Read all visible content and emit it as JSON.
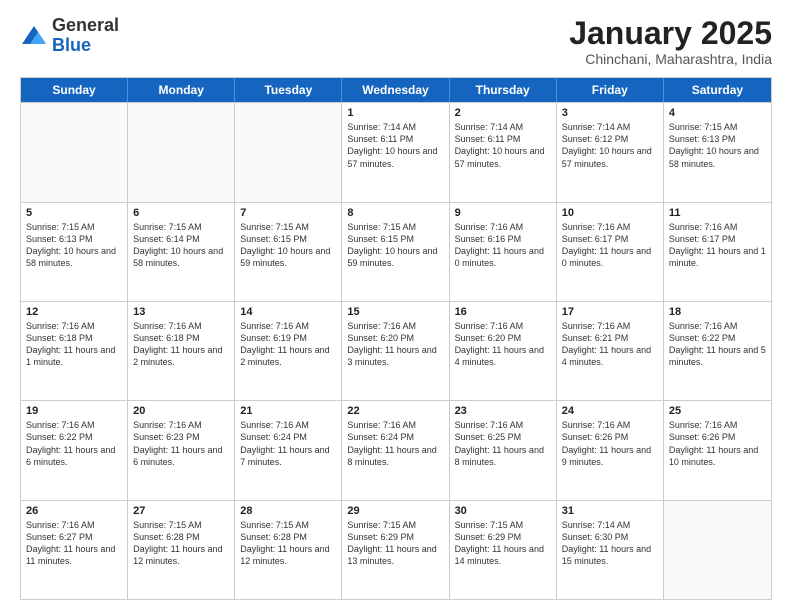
{
  "logo": {
    "general": "General",
    "blue": "Blue"
  },
  "header": {
    "month": "January 2025",
    "location": "Chinchani, Maharashtra, India"
  },
  "weekdays": [
    "Sunday",
    "Monday",
    "Tuesday",
    "Wednesday",
    "Thursday",
    "Friday",
    "Saturday"
  ],
  "rows": [
    [
      {
        "day": "",
        "empty": true
      },
      {
        "day": "",
        "empty": true
      },
      {
        "day": "",
        "empty": true
      },
      {
        "day": "1",
        "sunrise": "7:14 AM",
        "sunset": "6:11 PM",
        "daylight": "10 hours and 57 minutes."
      },
      {
        "day": "2",
        "sunrise": "7:14 AM",
        "sunset": "6:11 PM",
        "daylight": "10 hours and 57 minutes."
      },
      {
        "day": "3",
        "sunrise": "7:14 AM",
        "sunset": "6:12 PM",
        "daylight": "10 hours and 57 minutes."
      },
      {
        "day": "4",
        "sunrise": "7:15 AM",
        "sunset": "6:13 PM",
        "daylight": "10 hours and 58 minutes."
      }
    ],
    [
      {
        "day": "5",
        "sunrise": "7:15 AM",
        "sunset": "6:13 PM",
        "daylight": "10 hours and 58 minutes."
      },
      {
        "day": "6",
        "sunrise": "7:15 AM",
        "sunset": "6:14 PM",
        "daylight": "10 hours and 58 minutes."
      },
      {
        "day": "7",
        "sunrise": "7:15 AM",
        "sunset": "6:15 PM",
        "daylight": "10 hours and 59 minutes."
      },
      {
        "day": "8",
        "sunrise": "7:15 AM",
        "sunset": "6:15 PM",
        "daylight": "10 hours and 59 minutes."
      },
      {
        "day": "9",
        "sunrise": "7:16 AM",
        "sunset": "6:16 PM",
        "daylight": "11 hours and 0 minutes."
      },
      {
        "day": "10",
        "sunrise": "7:16 AM",
        "sunset": "6:17 PM",
        "daylight": "11 hours and 0 minutes."
      },
      {
        "day": "11",
        "sunrise": "7:16 AM",
        "sunset": "6:17 PM",
        "daylight": "11 hours and 1 minute."
      }
    ],
    [
      {
        "day": "12",
        "sunrise": "7:16 AM",
        "sunset": "6:18 PM",
        "daylight": "11 hours and 1 minute."
      },
      {
        "day": "13",
        "sunrise": "7:16 AM",
        "sunset": "6:18 PM",
        "daylight": "11 hours and 2 minutes."
      },
      {
        "day": "14",
        "sunrise": "7:16 AM",
        "sunset": "6:19 PM",
        "daylight": "11 hours and 2 minutes."
      },
      {
        "day": "15",
        "sunrise": "7:16 AM",
        "sunset": "6:20 PM",
        "daylight": "11 hours and 3 minutes."
      },
      {
        "day": "16",
        "sunrise": "7:16 AM",
        "sunset": "6:20 PM",
        "daylight": "11 hours and 4 minutes."
      },
      {
        "day": "17",
        "sunrise": "7:16 AM",
        "sunset": "6:21 PM",
        "daylight": "11 hours and 4 minutes."
      },
      {
        "day": "18",
        "sunrise": "7:16 AM",
        "sunset": "6:22 PM",
        "daylight": "11 hours and 5 minutes."
      }
    ],
    [
      {
        "day": "19",
        "sunrise": "7:16 AM",
        "sunset": "6:22 PM",
        "daylight": "11 hours and 6 minutes."
      },
      {
        "day": "20",
        "sunrise": "7:16 AM",
        "sunset": "6:23 PM",
        "daylight": "11 hours and 6 minutes."
      },
      {
        "day": "21",
        "sunrise": "7:16 AM",
        "sunset": "6:24 PM",
        "daylight": "11 hours and 7 minutes."
      },
      {
        "day": "22",
        "sunrise": "7:16 AM",
        "sunset": "6:24 PM",
        "daylight": "11 hours and 8 minutes."
      },
      {
        "day": "23",
        "sunrise": "7:16 AM",
        "sunset": "6:25 PM",
        "daylight": "11 hours and 8 minutes."
      },
      {
        "day": "24",
        "sunrise": "7:16 AM",
        "sunset": "6:26 PM",
        "daylight": "11 hours and 9 minutes."
      },
      {
        "day": "25",
        "sunrise": "7:16 AM",
        "sunset": "6:26 PM",
        "daylight": "11 hours and 10 minutes."
      }
    ],
    [
      {
        "day": "26",
        "sunrise": "7:16 AM",
        "sunset": "6:27 PM",
        "daylight": "11 hours and 11 minutes."
      },
      {
        "day": "27",
        "sunrise": "7:15 AM",
        "sunset": "6:28 PM",
        "daylight": "11 hours and 12 minutes."
      },
      {
        "day": "28",
        "sunrise": "7:15 AM",
        "sunset": "6:28 PM",
        "daylight": "11 hours and 12 minutes."
      },
      {
        "day": "29",
        "sunrise": "7:15 AM",
        "sunset": "6:29 PM",
        "daylight": "11 hours and 13 minutes."
      },
      {
        "day": "30",
        "sunrise": "7:15 AM",
        "sunset": "6:29 PM",
        "daylight": "11 hours and 14 minutes."
      },
      {
        "day": "31",
        "sunrise": "7:14 AM",
        "sunset": "6:30 PM",
        "daylight": "11 hours and 15 minutes."
      },
      {
        "day": "",
        "empty": true
      }
    ]
  ]
}
